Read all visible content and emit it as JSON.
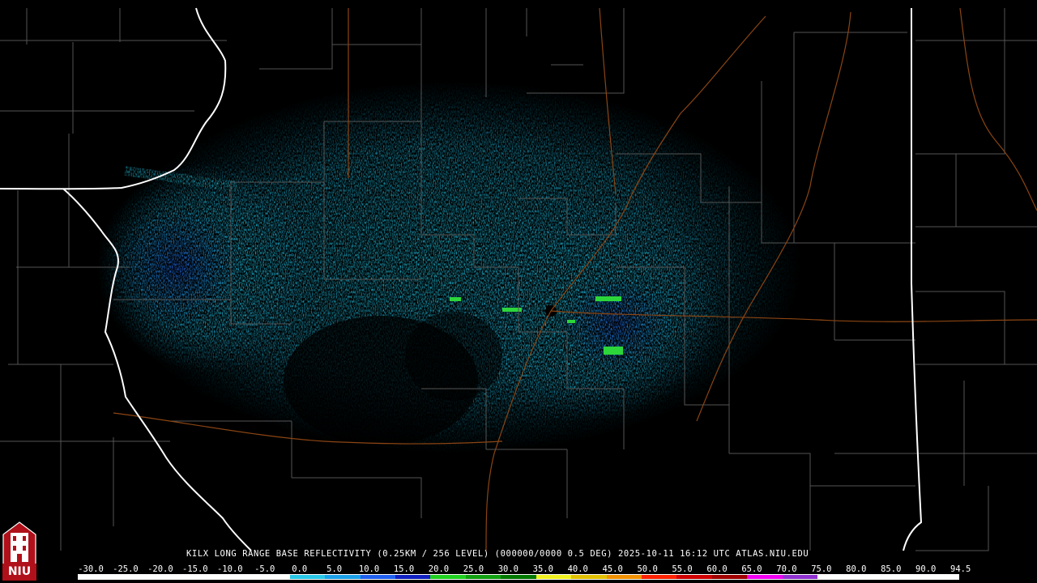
{
  "caption": "KILX LONG RANGE BASE REFLECTIVITY (0.25KM / 256 LEVEL) (000000/0000 0.5 DEG) 2025-10-11 16:12 UTC  ATLAS.NIU.EDU",
  "scale_labels": [
    "-30.0",
    "-25.0",
    "-20.0",
    "-15.0",
    "-10.0",
    "-5.0",
    "0.0",
    "5.0",
    "10.0",
    "15.0",
    "20.0",
    "25.0",
    "30.0",
    "35.0",
    "40.0",
    "45.0",
    "50.0",
    "55.0",
    "60.0",
    "65.0",
    "70.0",
    "75.0",
    "80.0",
    "85.0",
    "90.0",
    "94.5"
  ],
  "scale_colors": [
    "#ffffff",
    "#ffffff",
    "#ffffff",
    "#ffffff",
    "#ffffff",
    "#ffffff",
    "#28c8e8",
    "#1aa0e8",
    "#2060f0",
    "#1020c0",
    "#20d020",
    "#10a010",
    "#007800",
    "#f0f020",
    "#e0c000",
    "#f09000",
    "#ff2000",
    "#d00000",
    "#a00000",
    "#f000f0",
    "#9030d0",
    "#ffffff",
    "#ffffff",
    "#ffffff",
    "#ffffff"
  ],
  "logo": {
    "text": "NIU",
    "icon": "niu-castle-logo-icon"
  },
  "legend_unit_colors": {
    "background": "#000000",
    "county_lines": "#555555",
    "state_lines": "#ffffff",
    "highways": "#8b4513"
  }
}
